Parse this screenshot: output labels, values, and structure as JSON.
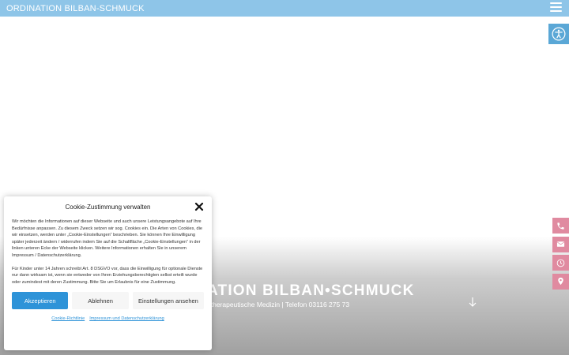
{
  "header": {
    "site_title": "ORDINATION BILBAN-SCHMUCK",
    "menu_icon": "hamburger-menu-icon"
  },
  "accessibility": {
    "icon": "accessibility-icon"
  },
  "hero": {
    "title": "ATION BILBAN•SCHMUCK",
    "subtitle": "otherapeutische Medizin | Telefon 03116 275 73",
    "arrow_icon": "arrow-down-icon"
  },
  "side_contacts": [
    {
      "icon": "phone-icon"
    },
    {
      "icon": "mail-icon"
    },
    {
      "icon": "clock-icon"
    },
    {
      "icon": "location-pin-icon"
    }
  ],
  "cookie": {
    "title": "Cookie-Zustimmung verwalten",
    "text_1": "Wir möchten die Informationen auf dieser Webseite und auch unsere Leistungsangebote auf Ihre Bedürfnisse anpassen. Zu diesem Zweck setzen wir sog. Cookies ein. Die Arten von Cookies, die wir einsetzen, werden unter „Cookie-Einstellungen“ beschrieben. Sie können Ihre Einwilligung später jederzeit ändern / widerrufen indem Sie auf die Schaltfläche „Cookie-Einstellungen“ in der linken unteren Ecke der Webseite klicken. Weitere Informationen erhalten Sie in unserem Impressum / Datenschutzerklärung.",
    "text_2": "Für Kinder unter 14 Jahren schreibt Art. 8 DSGVO vor, dass die Einwilligung für optionale Dienste nur dann wirksam ist, wenn sie entweder von Ihren Erziehungsberechtigten selbst erteilt wurde oder zumindest mit deren Zustimmung. Bitte Sie um Erlaubnis für eine Zustimmung.",
    "accept_label": "Akzeptieren",
    "deny_label": "Ablehnen",
    "prefs_label": "Einstellungen ansehen",
    "link_policy": "Cookie-Richtlinie",
    "link_imprint": "Impressum und Datenschutzerklärung",
    "accent": "#2e93d8"
  },
  "colors": {
    "topbar": "#8ec5e8",
    "accessibility": "#5aa7d6",
    "contact": "#e08aa0"
  }
}
